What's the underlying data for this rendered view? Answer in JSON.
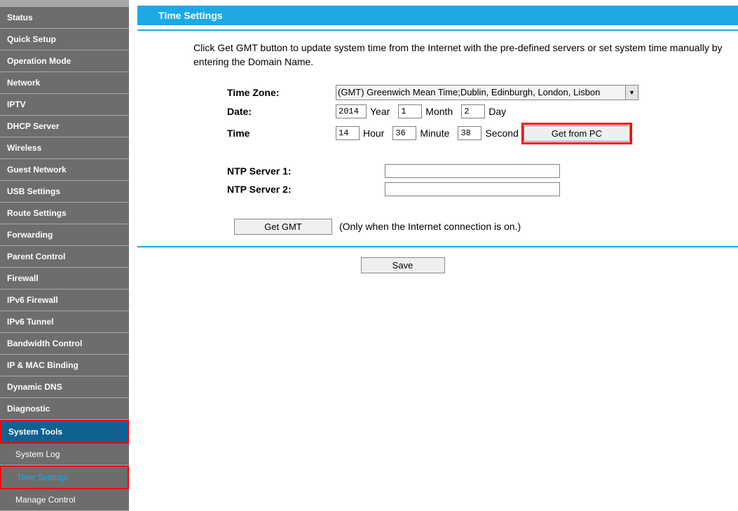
{
  "sidebar": {
    "items": [
      {
        "label": "Status"
      },
      {
        "label": "Quick Setup"
      },
      {
        "label": "Operation Mode"
      },
      {
        "label": "Network"
      },
      {
        "label": "IPTV"
      },
      {
        "label": "DHCP Server"
      },
      {
        "label": "Wireless"
      },
      {
        "label": "Guest Network"
      },
      {
        "label": "USB Settings"
      },
      {
        "label": "Route Settings"
      },
      {
        "label": "Forwarding"
      },
      {
        "label": "Parent Control"
      },
      {
        "label": "Firewall"
      },
      {
        "label": "IPv6 Firewall"
      },
      {
        "label": "IPv6 Tunnel"
      },
      {
        "label": "Bandwidth Control"
      },
      {
        "label": "IP & MAC Binding"
      },
      {
        "label": "Dynamic DNS"
      },
      {
        "label": "Diagnostic"
      },
      {
        "label": "System Tools"
      },
      {
        "label": "System Log"
      },
      {
        "label": "Time Settings"
      },
      {
        "label": "Manage Control"
      }
    ]
  },
  "page": {
    "title": "Time Settings",
    "intro": "Click Get GMT button to update system time from the Internet with the pre-defined servers or set system time manually by entering the Domain Name."
  },
  "form": {
    "timezone_label": "Time Zone:",
    "timezone_value": "(GMT) Greenwich Mean Time;Dublin, Edinburgh, London, Lisbon",
    "date_label": "Date:",
    "date_year": "2014",
    "year_lbl": "Year",
    "date_month": "1",
    "month_lbl": "Month",
    "date_day": "2",
    "day_lbl": "Day",
    "time_label": "Time",
    "time_hour": "14",
    "hour_lbl": "Hour",
    "time_min": "36",
    "min_lbl": "Minute",
    "time_sec": "38",
    "sec_lbl": "Second",
    "get_from_pc": "Get from PC",
    "ntp1_label": "NTP Server 1:",
    "ntp1_value": "",
    "ntp2_label": "NTP Server 2:",
    "ntp2_value": "",
    "get_gmt": "Get GMT",
    "gmt_note": "(Only when the Internet connection is on.)",
    "save": "Save"
  }
}
